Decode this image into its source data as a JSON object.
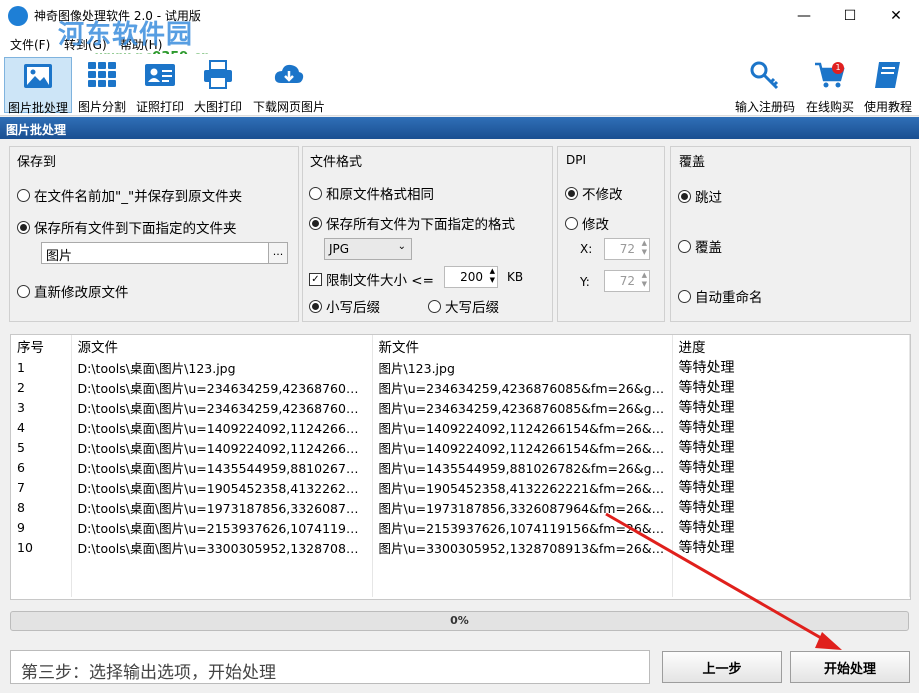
{
  "window": {
    "title": "神奇图像处理软件 2.0 - 试用版",
    "minimize": "—",
    "maximize": "☐",
    "close": "✕"
  },
  "watermark": {
    "text": "河东软件园",
    "url": "www.pc0359.cn"
  },
  "menu": [
    "文件(F)",
    "转到(G)",
    "帮助(H)"
  ],
  "toolbar": {
    "left": [
      {
        "label": "图片批处理",
        "icon": "image-icon"
      },
      {
        "label": "图片分割",
        "icon": "grid-icon"
      },
      {
        "label": "证照打印",
        "icon": "id-card-icon"
      },
      {
        "label": "大图打印",
        "icon": "printer-icon"
      },
      {
        "label": "下载网页图片",
        "icon": "cloud-download-icon"
      }
    ],
    "right": [
      {
        "label": "输入注册码",
        "icon": "key-icon"
      },
      {
        "label": "在线购买",
        "icon": "cart-icon",
        "badge": "1"
      },
      {
        "label": "使用教程",
        "icon": "book-icon"
      }
    ]
  },
  "section_header": "图片批处理",
  "save_panel": {
    "title": "保存到",
    "opt1": "在文件名前加\"_\"并保存到原文件夹",
    "opt2": "保存所有文件到下面指定的文件夹",
    "folder_value": "图片",
    "browse": "...",
    "opt3": "直新修改原文件"
  },
  "format_panel": {
    "title": "文件格式",
    "opt1": "和原文件格式相同",
    "opt2": "保存所有文件为下面指定的格式",
    "format_value": "JPG",
    "limit_label": "限制文件大小 <=",
    "limit_value": "200",
    "limit_unit": "KB",
    "lower": "小写后缀",
    "upper": "大写后缀"
  },
  "dpi_panel": {
    "title": "DPI",
    "opt1": "不修改",
    "opt2": "修改",
    "x_label": "X:",
    "x_value": "72",
    "y_label": "Y:",
    "y_value": "72"
  },
  "overwrite_panel": {
    "title": "覆盖",
    "opt1": "跳过",
    "opt2": "覆盖",
    "opt3": "自动重命名"
  },
  "table": {
    "headers": [
      "序号",
      "源文件",
      "新文件",
      "进度"
    ],
    "rows": [
      [
        "1",
        "D:\\tools\\桌面\\图片\\123.jpg",
        "图片\\123.jpg",
        "等特处理"
      ],
      [
        "2",
        "D:\\tools\\桌面\\图片\\u=234634259,4236876085...",
        "图片\\u=234634259,4236876085&fm=26&gp=0...",
        "等特处理"
      ],
      [
        "3",
        "D:\\tools\\桌面\\图片\\u=234634259,4236876085...",
        "图片\\u=234634259,4236876085&fm=26&gp=0...",
        "等特处理"
      ],
      [
        "4",
        "D:\\tools\\桌面\\图片\\u=1409224092,112426615...",
        "图片\\u=1409224092,1124266154&fm=26&gp=...",
        "等特处理"
      ],
      [
        "5",
        "D:\\tools\\桌面\\图片\\u=1409224092,112426615...",
        "图片\\u=1409224092,1124266154&fm=26&gp=...",
        "等特处理"
      ],
      [
        "6",
        "D:\\tools\\桌面\\图片\\u=1435544959,881026782...",
        "图片\\u=1435544959,881026782&fm=26&gp=0...",
        "等特处理"
      ],
      [
        "7",
        "D:\\tools\\桌面\\图片\\u=1905452358,413226222...",
        "图片\\u=1905452358,4132262221&fm=26&gp=...",
        "等特处理"
      ],
      [
        "8",
        "D:\\tools\\桌面\\图片\\u=1973187856,332608796...",
        "图片\\u=1973187856,3326087964&fm=26&gp=...",
        "等特处理"
      ],
      [
        "9",
        "D:\\tools\\桌面\\图片\\u=2153937626,107411915...",
        "图片\\u=2153937626,1074119156&fm=26&gp=...",
        "等特处理"
      ],
      [
        "10",
        "D:\\tools\\桌面\\图片\\u=3300305952,132870891...",
        "图片\\u=3300305952,1328708913&fm=26&gp=...",
        "等特处理"
      ]
    ]
  },
  "progress": {
    "value": 0,
    "text": "0%"
  },
  "status": "第三步：选择输出选项，开始处理",
  "buttons": {
    "prev": "上一步",
    "start": "开始处理"
  },
  "colors": {
    "accent": "#1a4f91",
    "arrow": "#e0201c"
  }
}
